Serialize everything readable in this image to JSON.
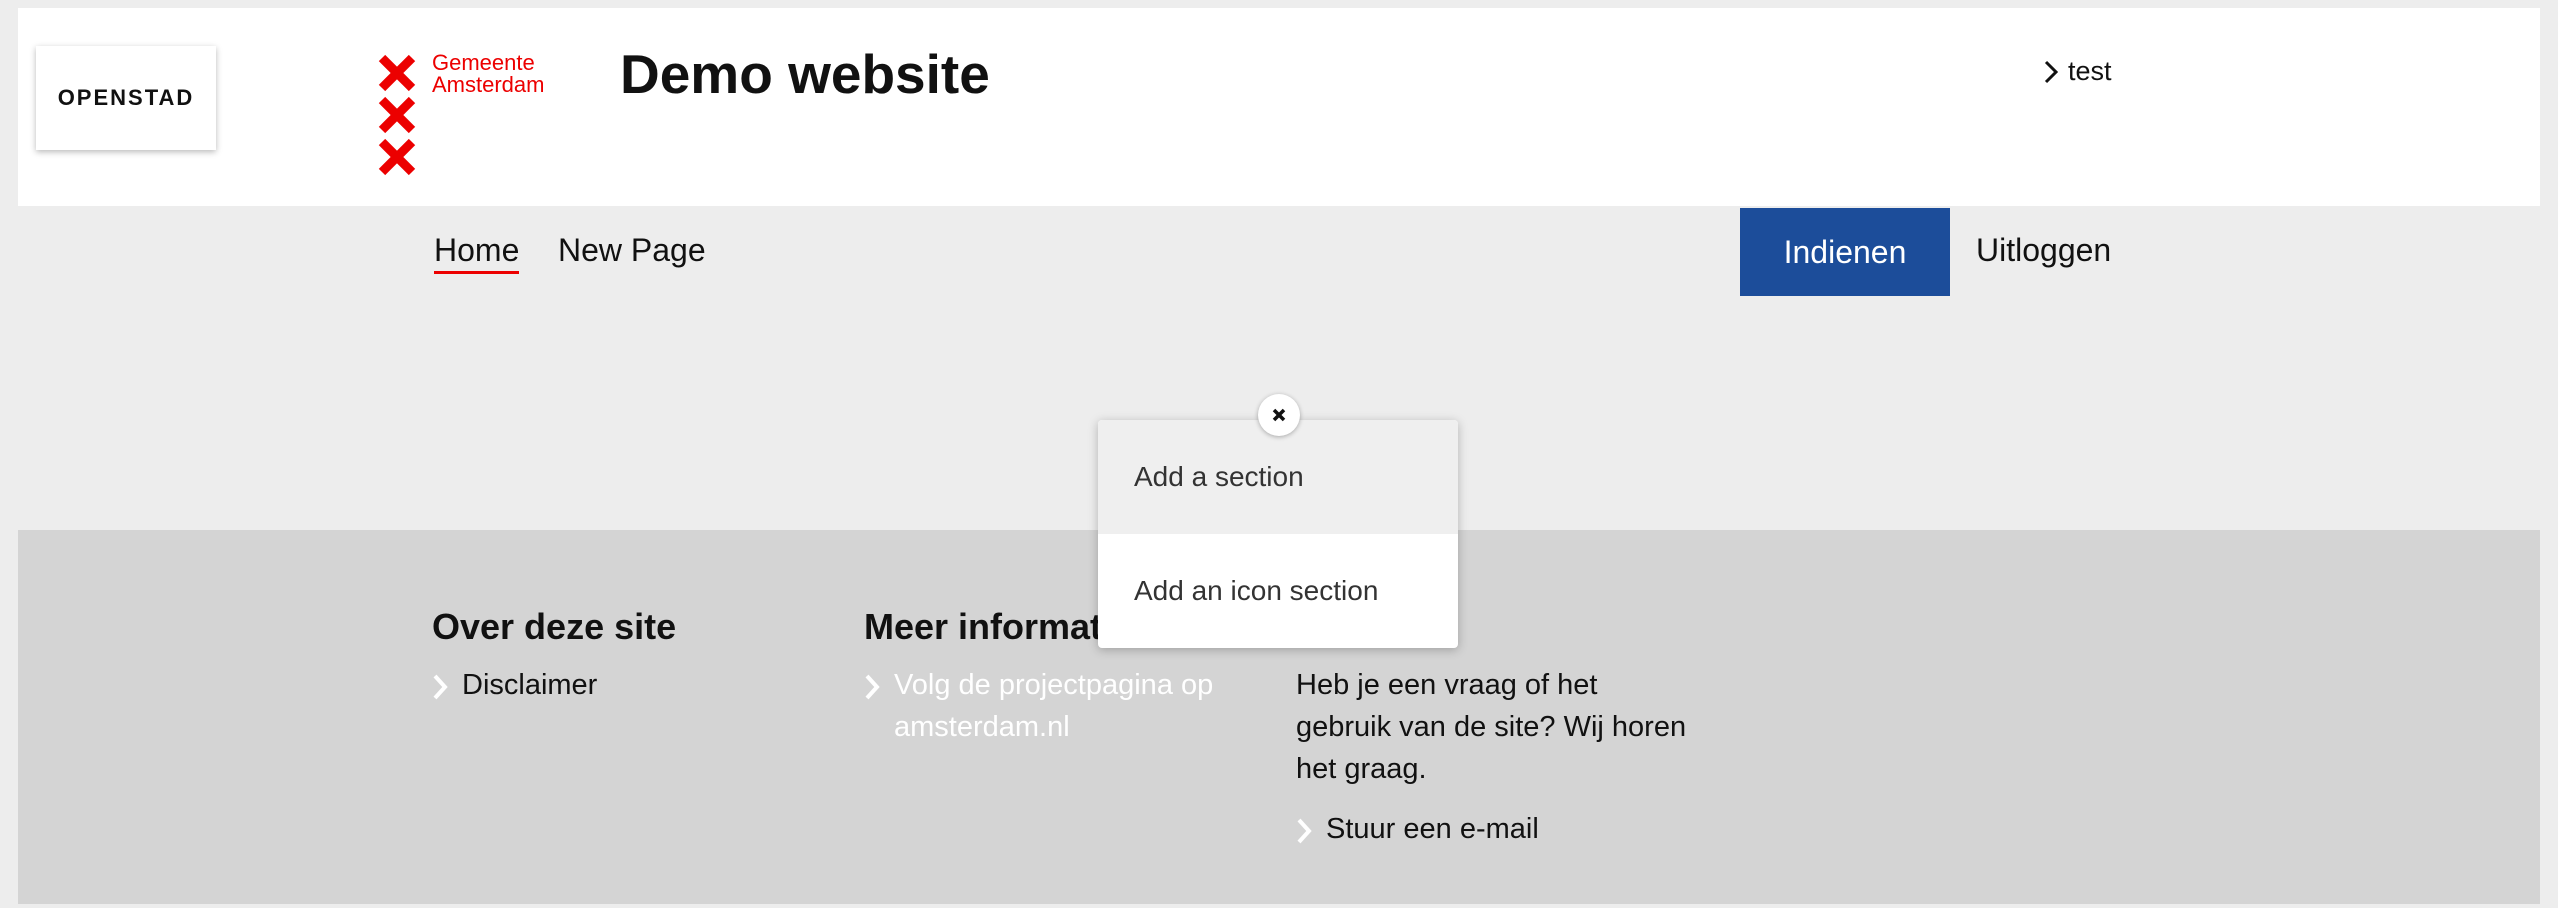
{
  "header": {
    "logo_openstad": "OPENSTAD",
    "municipality_line1": "Gemeente",
    "municipality_line2": "Amsterdam",
    "site_title": "Demo website",
    "user_link": "test"
  },
  "nav": {
    "items": [
      {
        "label": "Home",
        "active": true
      },
      {
        "label": "New Page",
        "active": false
      }
    ],
    "submit_button": "Indienen",
    "logout": "Uitloggen"
  },
  "popup": {
    "items": [
      "Add a section",
      "Add an icon section"
    ],
    "close_icon": "close-icon"
  },
  "footer": {
    "col1": {
      "heading": "Over deze site",
      "links": [
        "Disclaimer"
      ]
    },
    "col2": {
      "heading": "Meer informat",
      "link_line1": "Volg de projectpagina op",
      "link_line2": "amsterdam.nl"
    },
    "col3": {
      "text_line1": "Heb je een vraag of het",
      "text_line2": "gebruik van de site? Wij horen",
      "text_line3": "het graag.",
      "link": "Stuur een e-mail"
    }
  },
  "colors": {
    "brand_red": "#ec0000",
    "button_blue": "#1c4d9a",
    "footer_bg": "#d4d4d4",
    "nav_bg": "#ededed"
  }
}
